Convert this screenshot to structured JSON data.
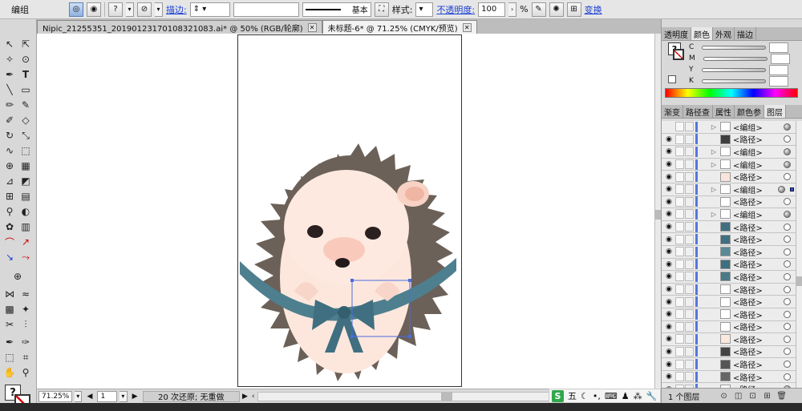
{
  "control_bar": {
    "mode_label": "编组",
    "stroke_label": "描边:",
    "stroke_style": "基本",
    "style_label": "样式:",
    "opacity_label": "不透明度:",
    "opacity_value": "100",
    "opacity_unit": "%",
    "transform_label": "变换"
  },
  "tabs": [
    {
      "label": "Nipic_21255351_20190123170108321083.ai* @ 50% (RGB/轮廓)",
      "active": false
    },
    {
      "label": "未标题-6* @ 71.25% (CMYK/预览)",
      "active": true
    }
  ],
  "panels": {
    "color_tabs": [
      "透明度",
      "颜色",
      "外观",
      "描边"
    ],
    "color_channels": [
      "C",
      "M",
      "Y",
      "K"
    ],
    "layer_tabs": [
      "渐变",
      "路径查",
      "属性",
      "颜色参",
      "图层"
    ],
    "layers_footer": "1 个图层"
  },
  "layers": [
    {
      "name": "<编组>",
      "group": true,
      "target": "filled"
    },
    {
      "name": "<路径>",
      "group": false,
      "target": "empty",
      "thumb": "#3f3f3f"
    },
    {
      "name": "<编组>",
      "group": true,
      "target": "filled"
    },
    {
      "name": "<编组>",
      "group": true,
      "target": "filled"
    },
    {
      "name": "<路径>",
      "group": false,
      "target": "empty",
      "thumb": "#f8e4dc"
    },
    {
      "name": "<编组>",
      "group": true,
      "target": "filled",
      "selected": true
    },
    {
      "name": "<路径>",
      "group": false,
      "target": "empty",
      "thumb": "#ffffff"
    },
    {
      "name": "<编组>",
      "group": true,
      "target": "filled"
    },
    {
      "name": "<路径>",
      "group": false,
      "target": "empty",
      "thumb": "#3f6f80"
    },
    {
      "name": "<路径>",
      "group": false,
      "target": "empty",
      "thumb": "#3f6f80"
    },
    {
      "name": "<路径>",
      "group": false,
      "target": "empty",
      "thumb": "#5a8a98"
    },
    {
      "name": "<路径>",
      "group": false,
      "target": "empty",
      "thumb": "#3f6f80"
    },
    {
      "name": "<路径>",
      "group": false,
      "target": "empty",
      "thumb": "#4a7a88"
    },
    {
      "name": "<路径>",
      "group": false,
      "target": "empty",
      "thumb": "#ffffff"
    },
    {
      "name": "<路径>",
      "group": false,
      "target": "empty",
      "thumb": "#ffffff"
    },
    {
      "name": "<路径>",
      "group": false,
      "target": "empty",
      "thumb": "#ffffff"
    },
    {
      "name": "<路径>",
      "group": false,
      "target": "empty",
      "thumb": "#ffffff"
    },
    {
      "name": "<路径>",
      "group": false,
      "target": "empty",
      "thumb": "#fbe9e0"
    },
    {
      "name": "<路径>",
      "group": false,
      "target": "empty",
      "thumb": "#444444"
    },
    {
      "name": "<路径>",
      "group": false,
      "target": "empty",
      "thumb": "#555555"
    },
    {
      "name": "<路径>",
      "group": false,
      "target": "empty",
      "thumb": "#666666"
    },
    {
      "name": "<路径>",
      "group": false,
      "target": "filled",
      "thumb": "#ffffff"
    }
  ],
  "status": {
    "zoom": "71.25%",
    "page": "1",
    "history": "20 次还原; 无重做"
  },
  "ime": {
    "brand": "S",
    "mode": "五"
  },
  "colors": {
    "hedgehog_spikes": "#6b6158",
    "hedgehog_face": "#fde7dd",
    "ribbon": "#3f6f80",
    "selection": "#4a6cdc"
  }
}
